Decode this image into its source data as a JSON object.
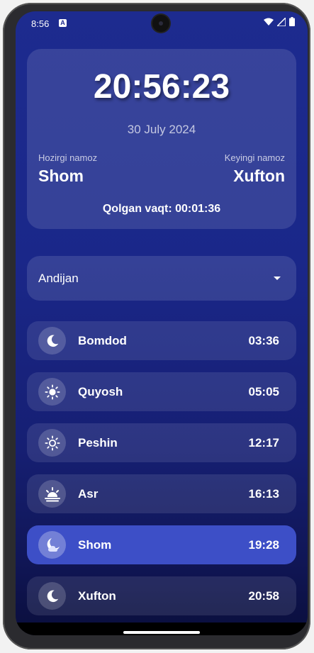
{
  "status_bar": {
    "time": "8:56",
    "notification_icon": "A"
  },
  "clock": {
    "time": "20:56:23",
    "date": "30 July 2024"
  },
  "current": {
    "label": "Hozirgi namoz",
    "name": "Shom"
  },
  "next": {
    "label": "Keyingi namoz",
    "name": "Xufton"
  },
  "remaining": "Qolgan vaqt: 00:01:36",
  "city_select": {
    "selected": "Andijan"
  },
  "prayers": [
    {
      "name": "Bomdod",
      "time": "03:36",
      "icon": "moon-icon"
    },
    {
      "name": "Quyosh",
      "time": "05:05",
      "icon": "sun-filled-icon"
    },
    {
      "name": "Peshin",
      "time": "12:17",
      "icon": "sun-outline-icon"
    },
    {
      "name": "Asr",
      "time": "16:13",
      "icon": "sunset-icon"
    },
    {
      "name": "Shom",
      "time": "19:28",
      "icon": "moon-cloud-icon",
      "active": true
    },
    {
      "name": "Xufton",
      "time": "20:58",
      "icon": "moon-icon"
    }
  ],
  "colors": {
    "accent": "#3d4fc7",
    "background": "#1d2b8f"
  }
}
